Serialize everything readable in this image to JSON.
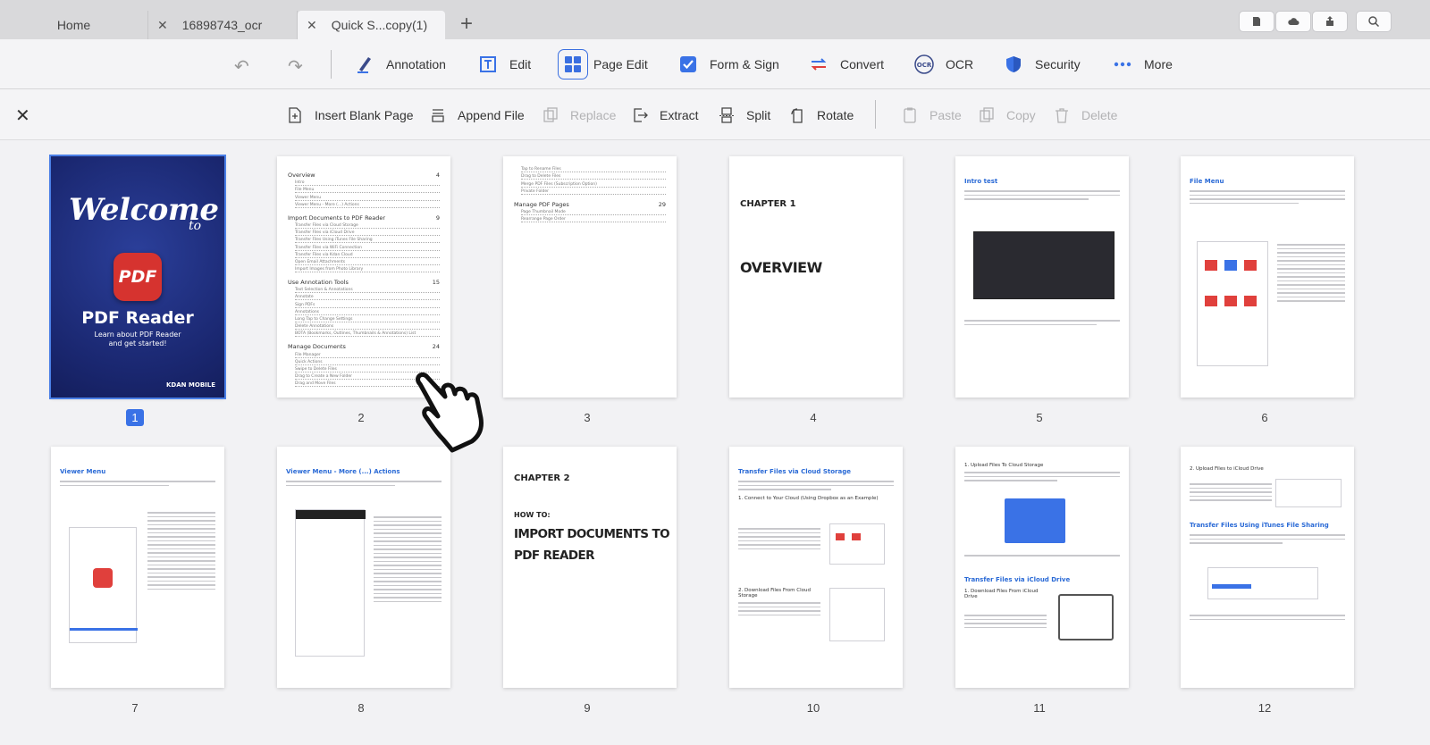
{
  "tabs": [
    {
      "label": "Home"
    },
    {
      "label": "16898743_ocr"
    },
    {
      "label": "Quick S...copy(1)"
    }
  ],
  "toolbar": {
    "annotation": "Annotation",
    "edit": "Edit",
    "page_edit": "Page Edit",
    "form_sign": "Form & Sign",
    "convert": "Convert",
    "ocr": "OCR",
    "security": "Security",
    "more": "More"
  },
  "page_edit_bar": {
    "insert_blank_page": "Insert Blank Page",
    "append_file": "Append File",
    "replace": "Replace",
    "extract": "Extract",
    "split": "Split",
    "rotate": "Rotate",
    "paste": "Paste",
    "copy": "Copy",
    "delete": "Delete"
  },
  "pages": [
    {
      "number": "1",
      "selected": true
    },
    {
      "number": "2"
    },
    {
      "number": "3"
    },
    {
      "number": "4"
    },
    {
      "number": "5"
    },
    {
      "number": "6"
    },
    {
      "number": "7"
    },
    {
      "number": "8"
    },
    {
      "number": "9"
    },
    {
      "number": "10"
    },
    {
      "number": "11"
    },
    {
      "number": "12"
    }
  ],
  "thumbs": {
    "cover": {
      "welcome": "Welcome",
      "to": "to",
      "logo": "PDF",
      "name": "PDF Reader",
      "sub1": "Learn about PDF Reader",
      "sub2": "and get started!",
      "brand": "KDAN MOBILE"
    },
    "toc2": [
      {
        "h": "Overview",
        "p": "4",
        "rows": [
          "Intro",
          "File Menu",
          "Viewer Menu",
          "Viewer Menu - More (...) Actions"
        ]
      },
      {
        "h": "Import Documents to PDF Reader",
        "p": "9",
        "rows": [
          "Transfer Files via Cloud Storage",
          "Transfer Files via iCloud Drive",
          "Transfer Files Using iTunes File Sharing",
          "Transfer Files via WiFi Connection",
          "Transfer Files via Kdan Cloud",
          "Open Email Attachments",
          "Import Images from Photo Library"
        ]
      },
      {
        "h": "Use Annotation Tools",
        "p": "15",
        "rows": [
          "Text Selection & Annotations",
          "Annotate",
          "Sign PDFs",
          "Annotations",
          "Long Tap to Change Settings",
          "Delete Annotations",
          "BOTA (Bookmarks, Outlines, Thumbnails & Annotations) List"
        ]
      },
      {
        "h": "Manage Documents",
        "p": "24",
        "rows": [
          "File Manager",
          "Quick Actions",
          "Swipe to Delete Files",
          "Drag to Create a New Folder",
          "Drag and Move Files"
        ]
      }
    ],
    "toc3": [
      {
        "h": "",
        "p": "",
        "rows": [
          "Tap to Rename Files",
          "Drag to Delete Files",
          "Merge PDF Files (Subscription Option)",
          "Private Folder"
        ]
      },
      {
        "h": "Manage PDF Pages",
        "p": "29",
        "rows": [
          "Page Thumbnail Mode",
          "Rearrange Page Order"
        ]
      }
    ],
    "chapter1": {
      "label": "CHAPTER 1",
      "title": "OVERVIEW"
    },
    "chapter2": {
      "label": "CHAPTER 2",
      "howto": "HOW TO:",
      "title1": "IMPORT DOCUMENTS TO",
      "title2": "PDF READER"
    },
    "p5_title": "Intro test",
    "p6_title": "File Menu",
    "p7_title": "Viewer Menu",
    "p8_title": "Viewer Menu - More (...) Actions",
    "p10_title": "Transfer Files via Cloud Storage",
    "p10_s1": "1.  Connect to Your Cloud (Using Dropbox as an Example)",
    "p10_s2": "2.  Download Files From Cloud Storage",
    "p11_s1": "1.  Upload Files To Cloud Storage",
    "p11_title": "Transfer Files via iCloud Drive",
    "p11_s2": "1.  Download Files From iCloud Drive",
    "p12_s1": "2.  Upload Files to iCloud Drive",
    "p12_title": "Transfer Files Using iTunes File Sharing"
  },
  "colors": {
    "accent": "#3a72e6",
    "brand_red": "#d6332f",
    "cover_blue": "#1a2770"
  }
}
